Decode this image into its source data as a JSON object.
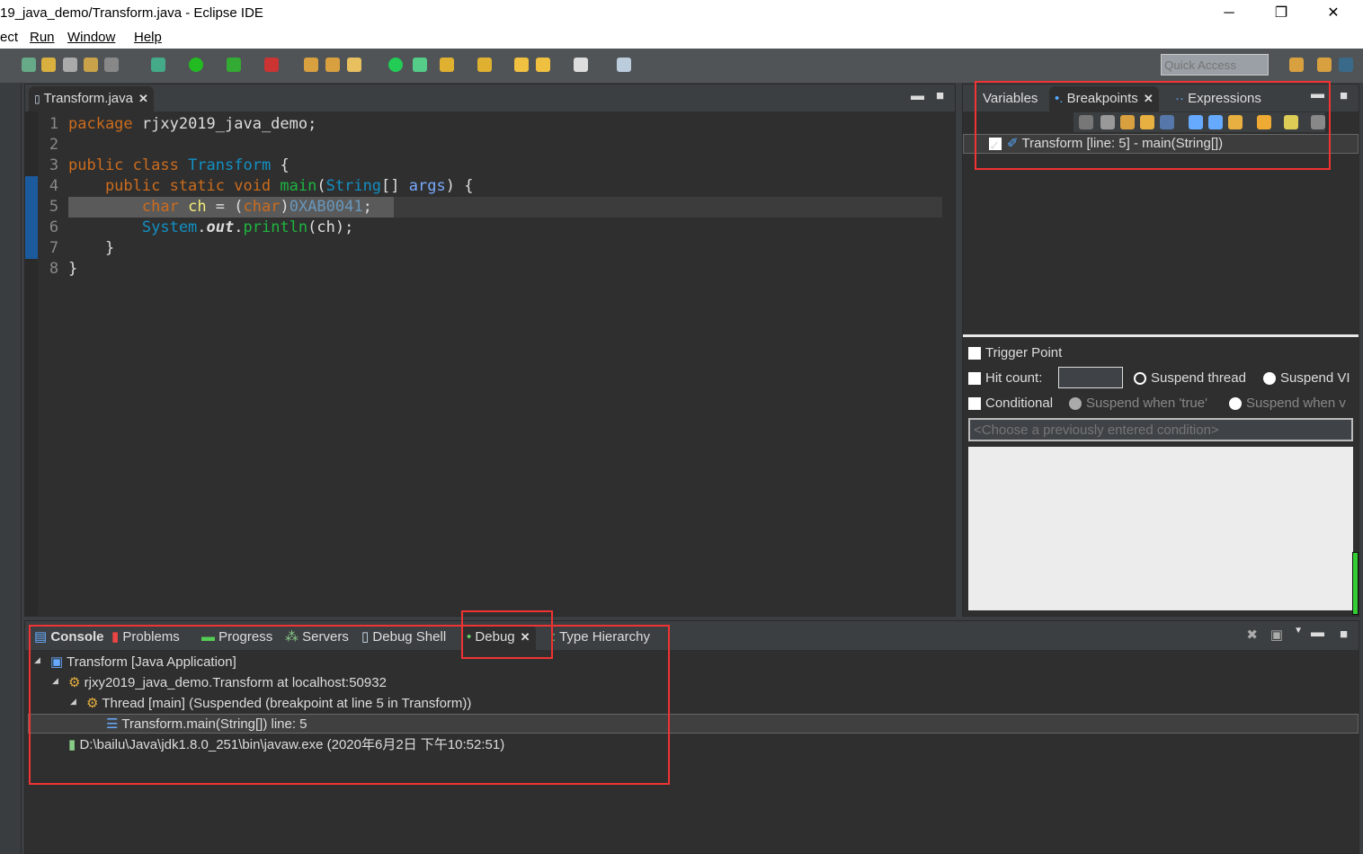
{
  "window": {
    "title": "19_java_demo/Transform.java - Eclipse IDE",
    "minimize": "─",
    "restore": "❐",
    "close": "✕"
  },
  "menu": [
    "ect",
    "Run",
    "Window",
    "Help"
  ],
  "toolbar": {
    "quick_access_placeholder": "Quick Access"
  },
  "editor": {
    "tab": "Transform.java",
    "line_numbers": [
      "1",
      "2",
      "3",
      "4",
      "5",
      "6",
      "7",
      "8"
    ],
    "lines": [
      [
        {
          "t": "package",
          "c": "kw"
        },
        {
          "t": " rjxy2019_java_demo;",
          "c": ""
        }
      ],
      [],
      [
        {
          "t": "public class",
          "c": "kw"
        },
        {
          "t": " ",
          "c": ""
        },
        {
          "t": "Transform",
          "c": "ty"
        },
        {
          "t": " {",
          "c": ""
        }
      ],
      [
        {
          "t": "    public static void",
          "c": "kw"
        },
        {
          "t": " ",
          "c": ""
        },
        {
          "t": "main",
          "c": "fn"
        },
        {
          "t": "(",
          "c": ""
        },
        {
          "t": "String",
          "c": "ty"
        },
        {
          "t": "[] ",
          "c": ""
        },
        {
          "t": "args",
          "c": "arg"
        },
        {
          "t": ") {",
          "c": ""
        }
      ],
      [
        {
          "t": "        char",
          "c": "kw"
        },
        {
          "t": " ",
          "c": ""
        },
        {
          "t": "ch",
          "c": "var"
        },
        {
          "t": " = (",
          "c": ""
        },
        {
          "t": "char",
          "c": "kw"
        },
        {
          "t": ")",
          "c": ""
        },
        {
          "t": "0XAB0041",
          "c": "num"
        },
        {
          "t": ";",
          "c": ""
        }
      ],
      [
        {
          "t": "        System",
          "c": "ty"
        },
        {
          "t": ".",
          "c": ""
        },
        {
          "t": "out",
          "c": "out"
        },
        {
          "t": ".",
          "c": ""
        },
        {
          "t": "println",
          "c": "fn"
        },
        {
          "t": "(ch);",
          "c": ""
        }
      ],
      [
        {
          "t": "    }",
          "c": ""
        }
      ],
      [
        {
          "t": "}",
          "c": ""
        }
      ]
    ],
    "current_line": 5
  },
  "right_panel": {
    "tabs": [
      "Variables",
      "Breakpoints",
      "Expressions"
    ],
    "active_tab": "Breakpoints",
    "breakpoints": [
      {
        "label": "Transform [line: 5] - main(String[])",
        "checked": true
      }
    ],
    "trigger_point": "Trigger Point",
    "hit_count": "Hit count:",
    "hit_count_value": "",
    "suspend_thread": "Suspend thread",
    "suspend_vm": "Suspend VI",
    "conditional": "Conditional",
    "suspend_true": "Suspend when 'true'",
    "suspend_changed": "Suspend when v",
    "condition_placeholder": "<Choose a previously entered condition>"
  },
  "bottom_panel": {
    "tabs": [
      "Console",
      "Problems",
      "Progress",
      "Servers",
      "Debug Shell",
      "Debug",
      "Type Hierarchy"
    ],
    "active_tab": "Debug",
    "tree": [
      "Transform [Java Application]",
      "rjxy2019_java_demo.Transform at localhost:50932",
      "Thread [main] (Suspended (breakpoint at line 5 in Transform))",
      "Transform.main(String[]) line: 5",
      "D:\\bailu\\Java\\jdk1.8.0_251\\bin\\javaw.exe (2020年6月2日 下午10:52:51)"
    ]
  },
  "colors": {
    "annotation": "#f03333",
    "keyword": "#cc6c1d",
    "type": "#1290c3",
    "method": "#1eb540"
  }
}
